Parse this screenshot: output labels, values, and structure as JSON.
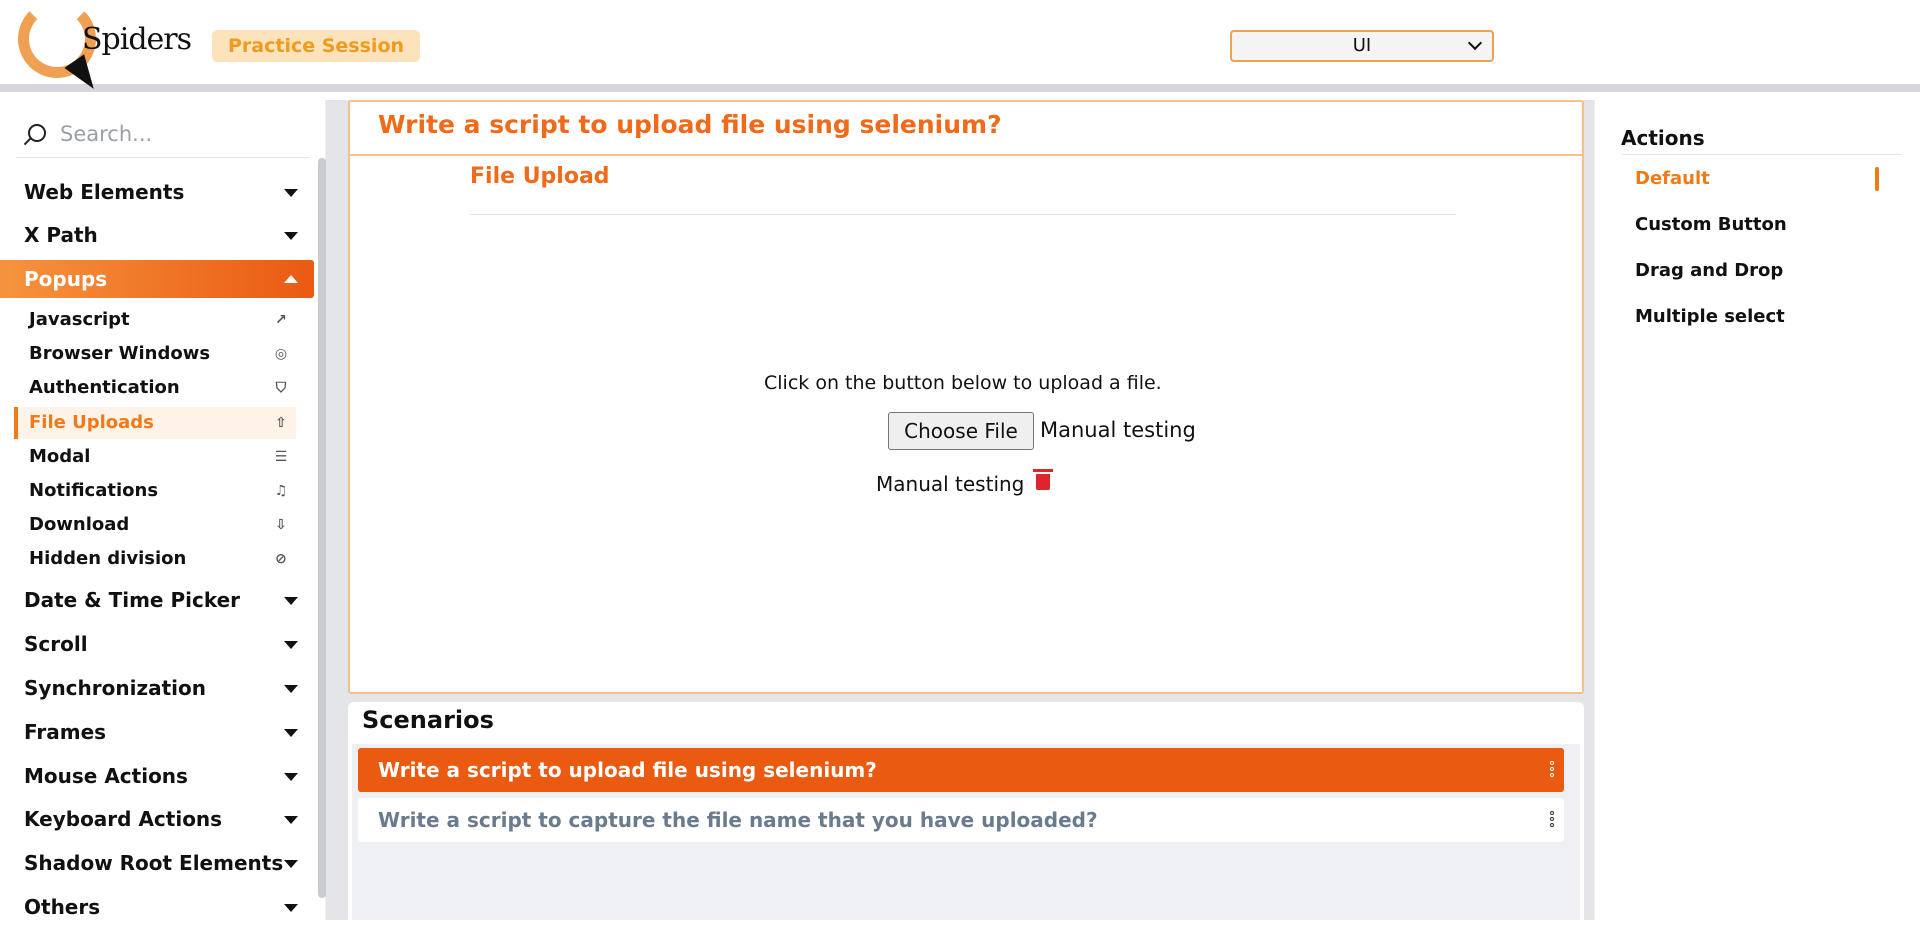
{
  "header": {
    "logo_text": "Spiders",
    "badge": "Practice Session",
    "select_value": "UI"
  },
  "sidebar": {
    "search_placeholder": "Search...",
    "groups_top": [
      {
        "label": "Web Elements"
      },
      {
        "label": "X Path"
      }
    ],
    "active_group": {
      "label": "Popups"
    },
    "sub_items": [
      {
        "label": "Javascript",
        "icon": "external-link-icon"
      },
      {
        "label": "Browser Windows",
        "icon": "globe-icon"
      },
      {
        "label": "Authentication",
        "icon": "shield-user-icon"
      },
      {
        "label": "File Uploads",
        "icon": "upload-icon"
      },
      {
        "label": "Modal",
        "icon": "message-icon"
      },
      {
        "label": "Notifications",
        "icon": "bell-icon"
      },
      {
        "label": "Download",
        "icon": "download-icon"
      },
      {
        "label": "Hidden division",
        "icon": "eye-off-icon"
      }
    ],
    "groups_bottom": [
      {
        "label": "Date & Time Picker"
      },
      {
        "label": "Scroll"
      },
      {
        "label": "Synchronization"
      },
      {
        "label": "Frames"
      },
      {
        "label": "Mouse Actions"
      },
      {
        "label": "Keyboard Actions"
      },
      {
        "label": "Shadow Root Elements"
      },
      {
        "label": "Others"
      }
    ]
  },
  "main": {
    "title": "Write a script to upload file using selenium?",
    "section_title": "File Upload",
    "instruction": "Click on the button below to upload a file.",
    "choose_button": "Choose File",
    "chosen_file": "Manual testing",
    "uploaded_file": "Manual testing"
  },
  "scenarios": {
    "title": "Scenarios",
    "items": [
      {
        "label": "Write a script to upload file using selenium?",
        "active": true
      },
      {
        "label": "Write a script to capture the file name that you have uploaded?",
        "active": false
      }
    ]
  },
  "actions": {
    "title": "Actions",
    "items": [
      {
        "label": "Default",
        "active": true
      },
      {
        "label": "Custom Button"
      },
      {
        "label": "Drag and Drop"
      },
      {
        "label": "Multiple select"
      }
    ]
  },
  "colors": {
    "accent": "#f07a1a",
    "accent_dark": "#ea5a10",
    "badge_bg": "#fde3bc",
    "delete": "#e0242c"
  }
}
